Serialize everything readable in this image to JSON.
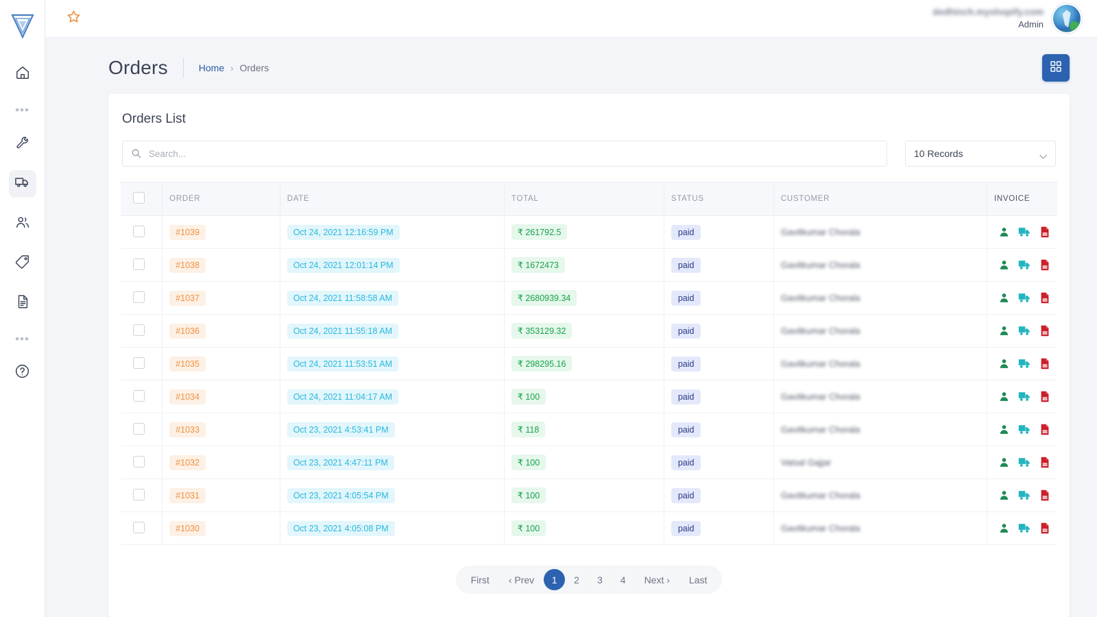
{
  "sidebar": {
    "brand": "logo-mark",
    "items": [
      {
        "name": "home",
        "icon": "home-icon"
      },
      {
        "name": "dots-1",
        "icon": "ellipsis-icon"
      },
      {
        "name": "settings",
        "icon": "wrench-icon"
      },
      {
        "name": "orders",
        "icon": "truck-icon",
        "active": true
      },
      {
        "name": "customers",
        "icon": "users-icon"
      },
      {
        "name": "products",
        "icon": "tag-icon"
      },
      {
        "name": "reports",
        "icon": "document-icon"
      },
      {
        "name": "dots-2",
        "icon": "ellipsis-icon"
      },
      {
        "name": "help",
        "icon": "help-circle-icon"
      }
    ],
    "ellipsis": "•••"
  },
  "topbar": {
    "star_icon": "star-icon",
    "store_name": "dedhinch.myshopify.com",
    "role": "Admin",
    "avatar": "user-avatar"
  },
  "pagehead": {
    "title": "Orders",
    "breadcrumb": {
      "home": "Home",
      "separator": "›",
      "current": "Orders"
    },
    "grid_button_icon": "grid-apps-icon"
  },
  "card": {
    "title": "Orders List",
    "search": {
      "placeholder": "Search...",
      "value": "",
      "icon": "search-icon"
    },
    "records_select": {
      "value": "10 Records",
      "icon": "chevron-down-icon"
    }
  },
  "table": {
    "headers": [
      "",
      "ORDER",
      "DATE",
      "TOTAL",
      "STATUS",
      "CUSTOMER",
      "INVOICE"
    ],
    "invoice_icons": [
      "customer-invoice-icon",
      "shipping-invoice-icon",
      "pdf-invoice-icon"
    ],
    "rows": [
      {
        "order": "#1039",
        "date": "Oct 24, 2021 12:16:59 PM",
        "total": "₹ 261792.5",
        "status": "paid",
        "customer": "Gavitkumar Chorala"
      },
      {
        "order": "#1038",
        "date": "Oct 24, 2021 12:01:14 PM",
        "total": "₹ 1672473",
        "status": "paid",
        "customer": "Gavitkumar Chorala"
      },
      {
        "order": "#1037",
        "date": "Oct 24, 2021 11:58:58 AM",
        "total": "₹ 2680939.34",
        "status": "paid",
        "customer": "Gavitkumar Chorala"
      },
      {
        "order": "#1036",
        "date": "Oct 24, 2021 11:55:18 AM",
        "total": "₹ 353129.32",
        "status": "paid",
        "customer": "Gavitkumar Chorala"
      },
      {
        "order": "#1035",
        "date": "Oct 24, 2021 11:53:51 AM",
        "total": "₹ 298295.16",
        "status": "paid",
        "customer": "Gavitkumar Chorala"
      },
      {
        "order": "#1034",
        "date": "Oct 24, 2021 11:04:17 AM",
        "total": "₹ 100",
        "status": "paid",
        "customer": "Gavitkumar Chorala"
      },
      {
        "order": "#1033",
        "date": "Oct 23, 2021 4:53:41 PM",
        "total": "₹ 118",
        "status": "paid",
        "customer": "Gavitkumar Chorala"
      },
      {
        "order": "#1032",
        "date": "Oct 23, 2021 4:47:11 PM",
        "total": "₹ 100",
        "status": "paid",
        "customer": "Vatsal Gajjar"
      },
      {
        "order": "#1031",
        "date": "Oct 23, 2021 4:05:54 PM",
        "total": "₹ 100",
        "status": "paid",
        "customer": "Gavitkumar Chorala"
      },
      {
        "order": "#1030",
        "date": "Oct 23, 2021 4:05:08 PM",
        "total": "₹ 100",
        "status": "paid",
        "customer": "Gavitkumar Chorala"
      }
    ]
  },
  "pagination": {
    "first": "First",
    "prev": "‹ Prev",
    "pages": [
      "1",
      "2",
      "3",
      "4"
    ],
    "active_page": "1",
    "next": "Next ›",
    "last": "Last"
  },
  "colors": {
    "accent_blue": "#2c62b0",
    "order_orange": "#ef9244",
    "date_cyan": "#2ab8e0",
    "total_green": "#17a34a",
    "paid_navy": "#2a3a86",
    "invoice_person_green": "#1f8a54",
    "invoice_truck_teal": "#22b5c0",
    "invoice_pdf_red": "#c9202a"
  }
}
